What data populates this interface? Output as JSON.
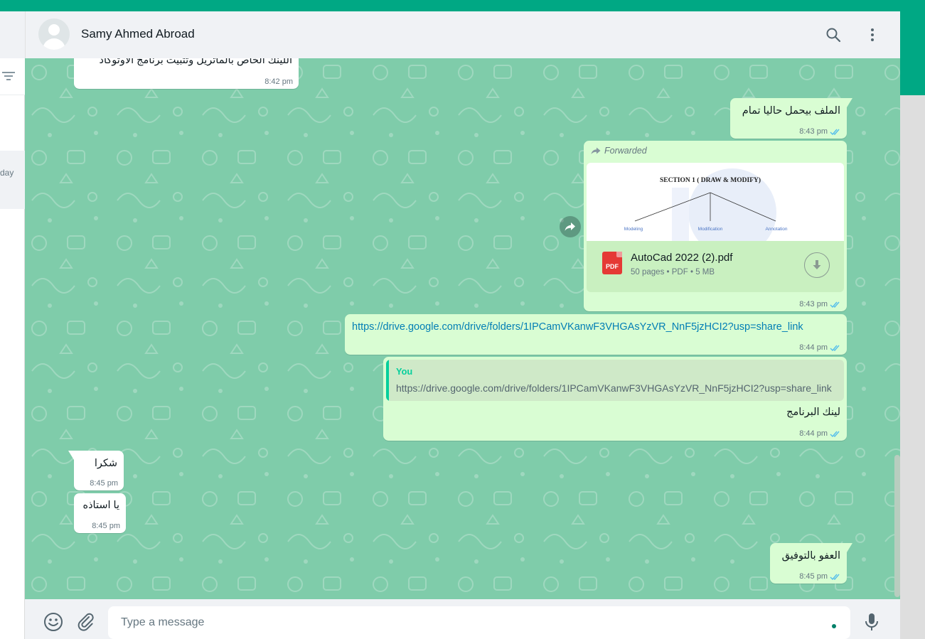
{
  "app": {
    "accent": "#00a884",
    "chat_bg": "#7fccaa",
    "outgoing_bubble": "#d9fdd3",
    "incoming_bubble": "#ffffff"
  },
  "left_panel": {
    "filter_icon": "filter-icon",
    "row_time_fragment": "day"
  },
  "header": {
    "contact_name": "Samy Ahmed Abroad",
    "icons": [
      "search-icon",
      "menu-dots-icon"
    ]
  },
  "messages": [
    {
      "dir": "in",
      "text": "اللينك الخاص بالماتريل  وتثبيت برنامج الاوتوكاد",
      "time": "8:42 pm"
    },
    {
      "dir": "out",
      "text": "الملف بيحمل حاليا تمام",
      "time": "8:43 pm"
    },
    {
      "dir": "out",
      "type": "document",
      "forwarded_label": "Forwarded",
      "preview": {
        "title": "SECTION 1 ( DRAW & MODIFY)",
        "nodes": [
          "Modeling",
          "Modification",
          "Annotation"
        ]
      },
      "file_name": "AutoCad 2022 (2).pdf",
      "pages": "50 pages",
      "file_type": "PDF",
      "size": "5 MB",
      "separator": "•",
      "time": "8:43 pm"
    },
    {
      "dir": "out",
      "type": "link",
      "text": "https://drive.google.com/drive/folders/1IPCamVKanwF3VHGAsYzVR_NnF5jzHCI2?usp=share_link",
      "time": "8:44 pm"
    },
    {
      "dir": "out",
      "type": "reply",
      "quote": {
        "author": "You",
        "text": "https://drive.google.com/drive/folders/1IPCamVKanwF3VHGAsYzVR_NnF5jzHCI2?usp=share_link"
      },
      "text": "لينك البرنامج",
      "time": "8:44 pm"
    },
    {
      "dir": "in",
      "text": "شكرا",
      "time": "8:45 pm"
    },
    {
      "dir": "in",
      "text": "يا استاذه",
      "time": "8:45 pm"
    },
    {
      "dir": "out",
      "text": "العفو بالتوفيق",
      "time": "8:45 pm"
    }
  ],
  "footer": {
    "placeholder": "Type a message",
    "value": "",
    "icons": [
      "emoji-icon",
      "attach-icon",
      "microphone-icon"
    ]
  }
}
